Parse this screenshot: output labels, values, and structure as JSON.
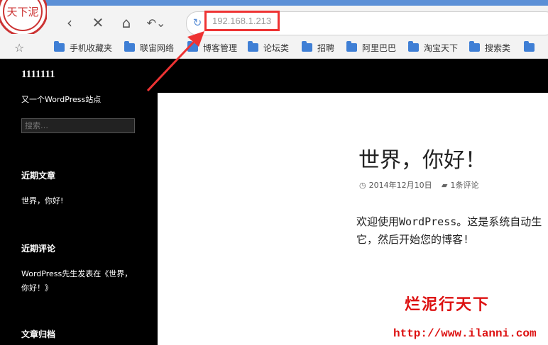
{
  "browser": {
    "url": "192.168.1.213",
    "nav": {
      "back": "back",
      "stop": "close",
      "home": "home",
      "undo": "undo"
    },
    "bookmarks": [
      "手机收藏夹",
      "联宙网络",
      "博客管理",
      "论坛类",
      "招聘",
      "阿里巴巴",
      "淘宝天下",
      "搜索类"
    ],
    "accent_color": "#5b8fd6",
    "highlight_color": "#ee3333"
  },
  "site": {
    "title": "1111111",
    "description": "又一个WordPress站点",
    "search_placeholder": "搜索…"
  },
  "widgets": {
    "recent_posts": {
      "title": "近期文章",
      "items": [
        "世界，你好!"
      ]
    },
    "recent_comments": {
      "title": "近期评论",
      "text": "WordPress先生发表在《世界，你好！》"
    },
    "archives": {
      "title": "文章归档"
    }
  },
  "post": {
    "title": "世界，你好！",
    "date": "2014年12月10日",
    "comments": "1条评论",
    "body_line1": "欢迎使用WordPress。这是系统自动生",
    "body_line2": "它，然后开始您的博客!"
  },
  "watermark": {
    "text": "烂泥行天下",
    "url": "http://www.ilanni.com"
  }
}
